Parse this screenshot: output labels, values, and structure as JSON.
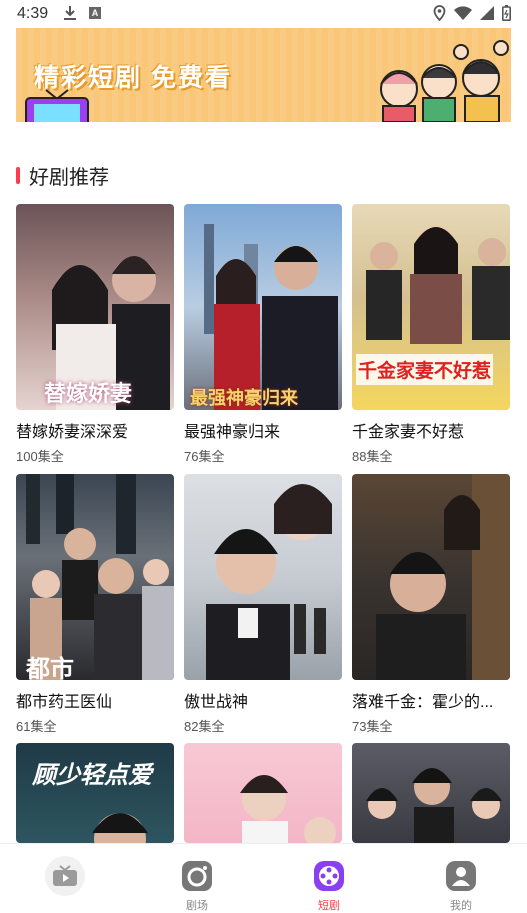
{
  "status": {
    "time": "4:39",
    "a_icon": "A"
  },
  "banner": {
    "text": "精彩短剧 免费看"
  },
  "section": {
    "title": "好剧推荐"
  },
  "dramas": [
    {
      "title": "替嫁娇妻深深爱",
      "episodes": "100集全",
      "overlay": "替嫁娇妻"
    },
    {
      "title": "最强神豪归来",
      "episodes": "76集全",
      "overlay": "最强神豪归来"
    },
    {
      "title": "千金家妻不好惹",
      "episodes": "88集全",
      "overlay": "千金家妻不好惹"
    },
    {
      "title": "都市药王医仙",
      "episodes": "61集全",
      "overlay": "都市"
    },
    {
      "title": "傲世战神",
      "episodes": "82集全",
      "overlay": ""
    },
    {
      "title": "落难千金：霍少的...",
      "episodes": "73集全",
      "overlay": ""
    },
    {
      "title": "",
      "episodes": "",
      "overlay": "顾少轻点爱"
    },
    {
      "title": "",
      "episodes": "",
      "overlay": ""
    },
    {
      "title": "",
      "episodes": "",
      "overlay": ""
    }
  ],
  "nav": {
    "items": [
      {
        "label": "",
        "icon": "tv-icon"
      },
      {
        "label": "剧场",
        "icon": "camera-icon"
      },
      {
        "label": "短剧",
        "icon": "film-reel-icon"
      },
      {
        "label": "我的",
        "icon": "person-icon"
      }
    ]
  },
  "colors": {
    "accent": "#ff3b4e",
    "banner": "#f9c777",
    "nav_active": "#8a3ff0"
  }
}
